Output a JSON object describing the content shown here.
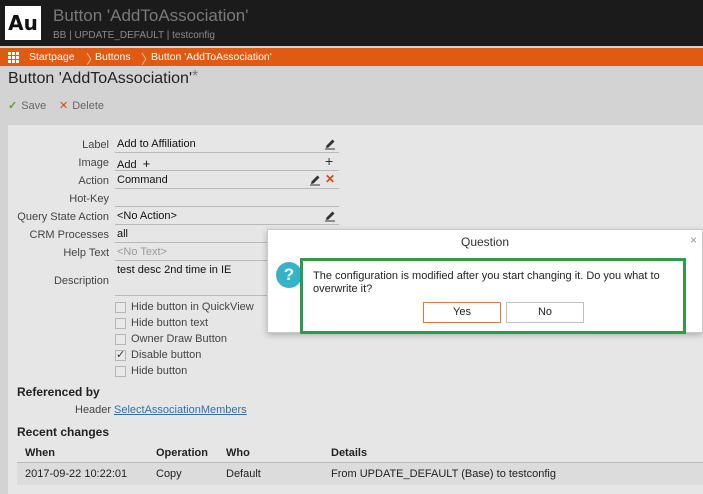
{
  "header": {
    "logo": "Au",
    "title": "Button 'AddToAssociation'",
    "subtitle": "BB | UPDATE_DEFAULT | testconfig"
  },
  "breadcrumb": [
    "Startpage",
    "Buttons",
    "Button 'AddToAssociation'"
  ],
  "page": {
    "title": "Button 'AddToAssociation'",
    "dirty_marker": "*"
  },
  "toolbar": {
    "save_label": "Save",
    "delete_label": "Delete"
  },
  "form": {
    "label": {
      "label": "Label",
      "value": "Add to Affiliation"
    },
    "image": {
      "label": "Image",
      "value": "Add"
    },
    "action": {
      "label": "Action",
      "value": "Command"
    },
    "hotkey": {
      "label": "Hot-Key",
      "value": ""
    },
    "query_state_action": {
      "label": "Query State Action",
      "value": "<No Action>"
    },
    "crm_processes": {
      "label": "CRM Processes",
      "value": "all"
    },
    "help_text": {
      "label": "Help Text",
      "placeholder": "<No Text>"
    },
    "description": {
      "label": "Description",
      "value": "test desc 2nd time in IE"
    },
    "checkboxes": [
      {
        "label": "Hide button in QuickView",
        "checked": false
      },
      {
        "label": "Hide button text",
        "checked": false
      },
      {
        "label": "Owner Draw Button",
        "checked": false
      },
      {
        "label": "Disable button",
        "checked": true
      },
      {
        "label": "Hide button",
        "checked": false
      }
    ]
  },
  "referenced_by": {
    "heading": "Referenced by",
    "label": "Header",
    "link": "SelectAssociationMembers"
  },
  "recent_changes": {
    "heading": "Recent changes",
    "columns": [
      "When",
      "Operation",
      "Who",
      "Details"
    ],
    "rows": [
      [
        "2017-09-22 10:22:01",
        "Copy",
        "Default",
        "From UPDATE_DEFAULT (Base) to testconfig"
      ]
    ]
  },
  "dialog": {
    "title": "Question",
    "close": "×",
    "icon": "?",
    "message": "The configuration is modified after you start changing it. Do you what to overwrite it?",
    "yes": "Yes",
    "no": "No"
  },
  "colors": {
    "accent": "#e05a12",
    "highlight": "#2e9b49",
    "info_icon": "#35b3c9"
  }
}
